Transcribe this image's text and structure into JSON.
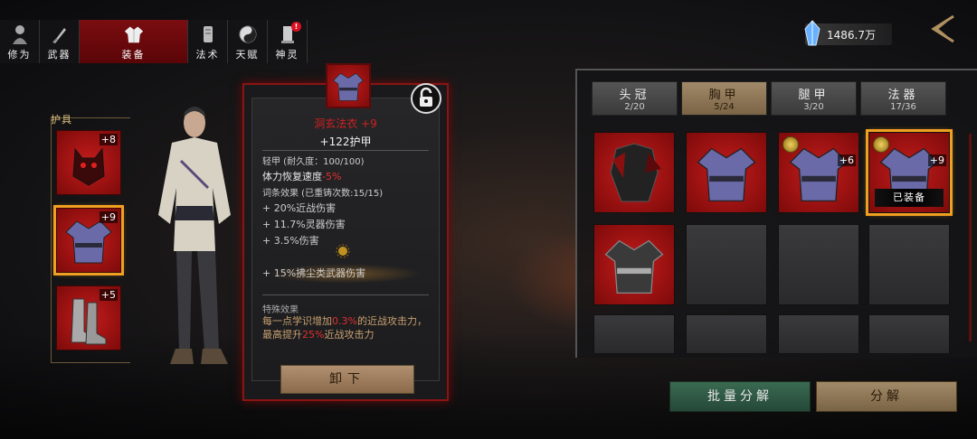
{
  "top_tabs": [
    {
      "label": "修为",
      "icon": "cultivator-icon"
    },
    {
      "label": "武器",
      "icon": "sword-icon"
    },
    {
      "label": "装备",
      "icon": "robe-icon",
      "active": true
    },
    {
      "label": "法术",
      "icon": "scroll-icon"
    },
    {
      "label": "天赋",
      "icon": "taiji-icon"
    },
    {
      "label": "神灵",
      "icon": "tablet-icon",
      "badge": "!"
    }
  ],
  "currency": {
    "value": "1486.7万",
    "icon": "spirit-crystal-icon"
  },
  "armor_panel": {
    "label": "护具",
    "slots": [
      {
        "name": "helmet",
        "level": "+8"
      },
      {
        "name": "chest",
        "level": "+9",
        "selected": true
      },
      {
        "name": "boots",
        "level": "+5"
      }
    ]
  },
  "tooltip": {
    "title": "洞玄法衣 +9",
    "armor_value": "+122护甲",
    "durability": "轻甲 (耐久度：100/100)",
    "stamina_label": "体力恢复速度",
    "stamina_value": "-5%",
    "affix_header": "词条效果 (已重铸次数:15/15)",
    "affixes": [
      {
        "text": "+ 20%近战伤害",
        "color": "red"
      },
      {
        "text": "+ 11.7%灵器伤害",
        "color": "tan"
      },
      {
        "text": "+ 3.5%伤害",
        "color": "gold"
      }
    ],
    "bonus_affix": "+ 15%拂尘类武器伤害",
    "special_header": "特殊效果",
    "special_text_a": "每一点学识增加",
    "special_value_a": "0.3%",
    "special_text_b": "的近战攻击力，最高提升",
    "special_value_b": "25%",
    "special_text_c": "近战攻击力",
    "unequip_label": "卸下"
  },
  "categories": [
    {
      "name": "头冠",
      "count": "2/20"
    },
    {
      "name": "胸甲",
      "count": "5/24",
      "active": true
    },
    {
      "name": "腿甲",
      "count": "3/20"
    },
    {
      "name": "法器",
      "count": "17/36"
    }
  ],
  "inventory": [
    {
      "type": "armor-dark-icon",
      "level": "",
      "coin": false
    },
    {
      "type": "robe-purple-icon",
      "level": "",
      "coin": false
    },
    {
      "type": "robe-purple-icon",
      "level": "+6",
      "coin": true
    },
    {
      "type": "robe-purple-icon",
      "level": "+9",
      "coin": true,
      "equipped": "已装备"
    },
    {
      "type": "robe-gray-icon",
      "level": "",
      "coin": false
    }
  ],
  "buttons": {
    "batch_decompose": "批量分解",
    "decompose": "分解"
  },
  "colors": {
    "accent_red": "#c41c1c",
    "selection_gold": "#f0a020",
    "tab_active": "#7a0d10"
  }
}
